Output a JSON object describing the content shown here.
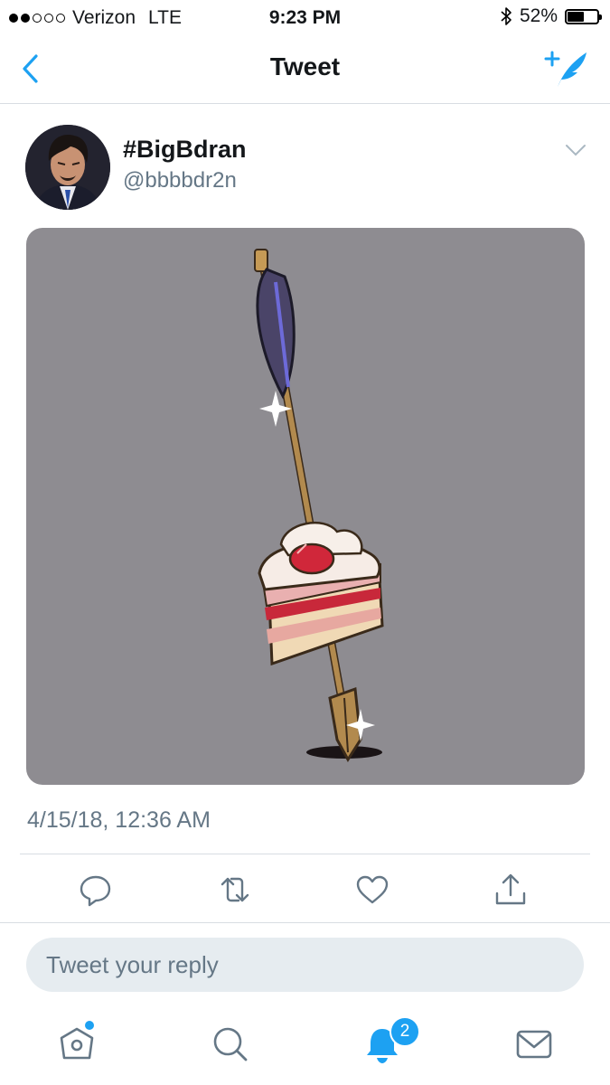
{
  "status_bar": {
    "carrier": "Verizon",
    "network": "LTE",
    "time": "9:23 PM",
    "battery": "52%",
    "battery_level": 0.52,
    "signal_bars": 2,
    "icons": [
      "bluetooth-icon",
      "battery-icon"
    ]
  },
  "nav": {
    "title": "Tweet",
    "back_icon": "chevron-left-icon",
    "compose_icon": "compose-tweet-icon"
  },
  "tweet": {
    "display_name": "#BigBdran",
    "handle": "@bbbbdr2n",
    "timestamp": "4/15/18, 12:36 AM",
    "media_description_icon": "arrow-through-cake-image"
  },
  "actions": {
    "icons": [
      "reply-icon",
      "retweet-icon",
      "like-icon",
      "share-icon"
    ]
  },
  "reply": {
    "placeholder": "Tweet your reply"
  },
  "tabbar": {
    "notifications_badge": "2",
    "icons": [
      "home-icon",
      "search-icon",
      "notifications-icon",
      "messages-icon"
    ]
  },
  "colors": {
    "accent": "#1da1f2",
    "secondary_text": "#657786",
    "media_background": "#8e8c91"
  }
}
